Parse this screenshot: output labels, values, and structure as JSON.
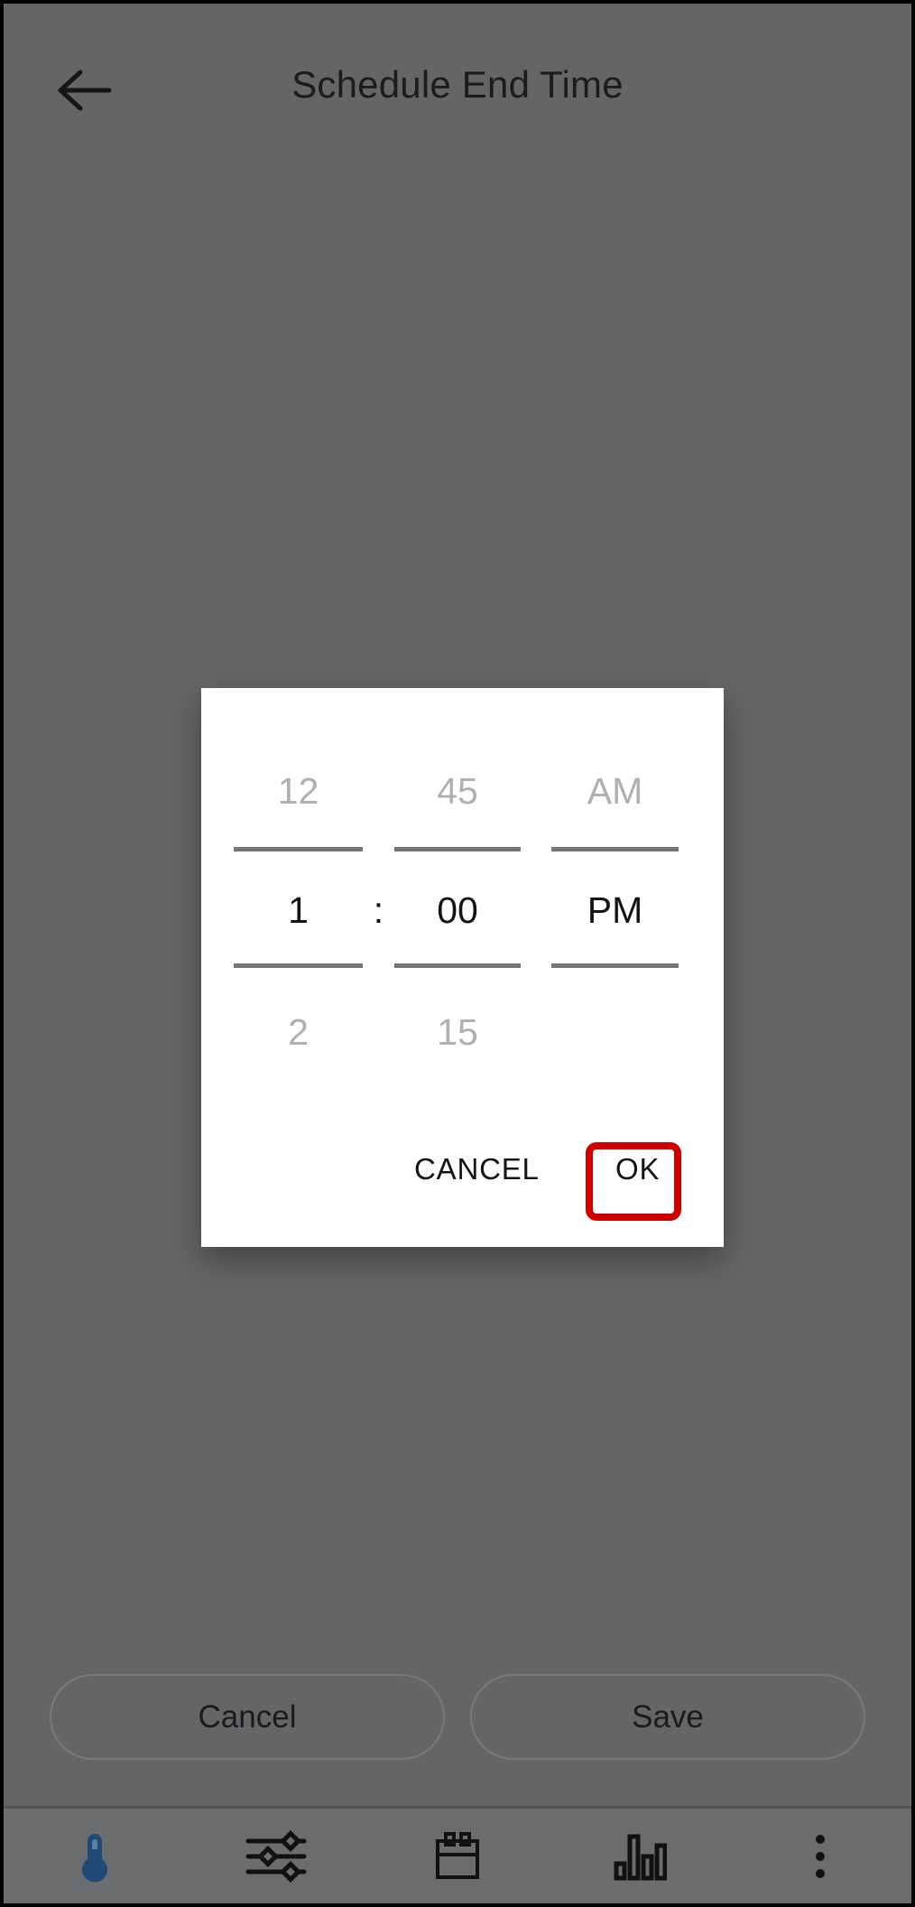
{
  "app": {
    "title": "Schedule End Time",
    "back_icon": "arrow-left-icon"
  },
  "dialog": {
    "type": "time-picker",
    "hour": {
      "previous": "12",
      "selected": "1",
      "next": "2"
    },
    "minute": {
      "previous": "45",
      "selected": "00",
      "next": "15"
    },
    "meridiem": {
      "previous": "AM",
      "selected": "PM",
      "next": ""
    },
    "separator": ":",
    "selected_time": "1:00 PM",
    "cancel_label": "CANCEL",
    "ok_label": "OK"
  },
  "annotation": {
    "target": "ok-dialog-button",
    "color": "#CC0000"
  },
  "bottom_actions": {
    "cancel_label": "Cancel",
    "save_label": "Save"
  },
  "bottom_nav": {
    "items": [
      {
        "icon": "thermometer-icon",
        "active": true,
        "color": "#1f4a78"
      },
      {
        "icon": "sliders-icon",
        "active": false,
        "color": "#111111"
      },
      {
        "icon": "calendar-icon",
        "active": false,
        "color": "#111111"
      },
      {
        "icon": "bar-chart-icon",
        "active": false,
        "color": "#111111"
      },
      {
        "icon": "overflow-menu-icon",
        "active": false,
        "color": "#111111"
      }
    ]
  },
  "colors": {
    "scrim_background": "#646567",
    "dialog_background": "#ffffff",
    "accent_red": "#CC0000",
    "nav_active_blue": "#1f4a78"
  }
}
